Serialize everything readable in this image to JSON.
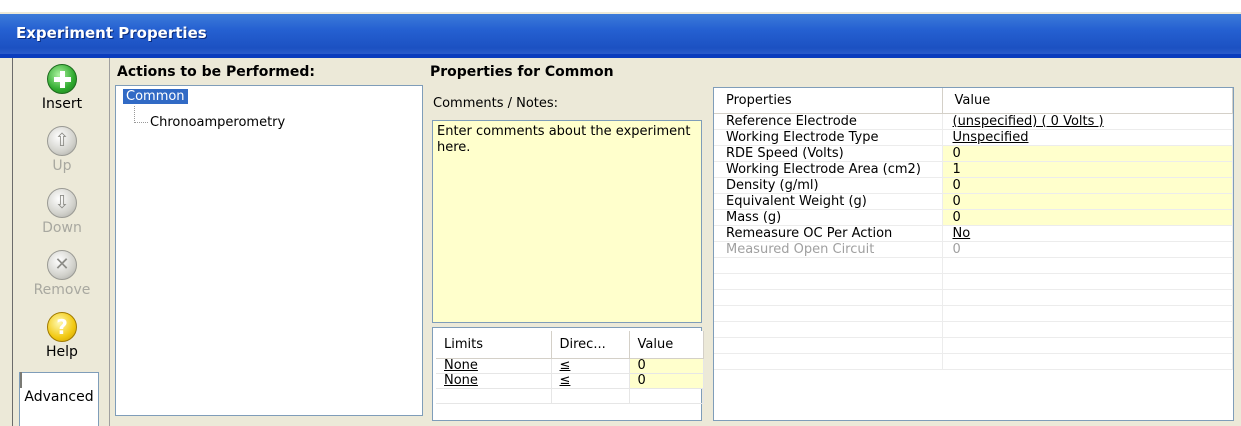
{
  "window": {
    "title": "Experiment Properties"
  },
  "toolbar": {
    "insert": "Insert",
    "up": "Up",
    "down": "Down",
    "remove": "Remove",
    "help": "Help",
    "advanced": "Advanced"
  },
  "actions": {
    "heading": "Actions to be Performed:",
    "root": "Common",
    "child": "Chronoamperometry"
  },
  "properties_for": {
    "heading": "Properties for Common"
  },
  "comments": {
    "label": "Comments / Notes:",
    "text": "Enter comments about the experiment here."
  },
  "limits": {
    "headers": [
      "Limits",
      "Direc...",
      "Value"
    ],
    "rows": [
      {
        "limit": "None",
        "direction": "≤",
        "value": "0"
      },
      {
        "limit": "None",
        "direction": "≤",
        "value": "0"
      }
    ]
  },
  "props": {
    "headers": [
      "Properties",
      "Value"
    ],
    "rows": [
      {
        "name": "Reference Electrode",
        "value": "(unspecified) ( 0 Volts )"
      },
      {
        "name": "Working Electrode Type",
        "value": "Unspecified"
      },
      {
        "name": "RDE Speed (Volts)",
        "value": "0"
      },
      {
        "name": "Working Electrode Area (cm2)",
        "value": "1"
      },
      {
        "name": "Density (g/ml)",
        "value": "0"
      },
      {
        "name": "Equivalent Weight (g)",
        "value": "0"
      },
      {
        "name": "Mass (g)",
        "value": "0"
      },
      {
        "name": "Remeasure OC Per Action",
        "value": "No"
      },
      {
        "name": "Measured Open Circuit",
        "value": "0"
      }
    ]
  },
  "colors": {
    "title_bar": "#2560d1",
    "selection": "#316ac5",
    "editable_cell": "#ffffcc"
  }
}
